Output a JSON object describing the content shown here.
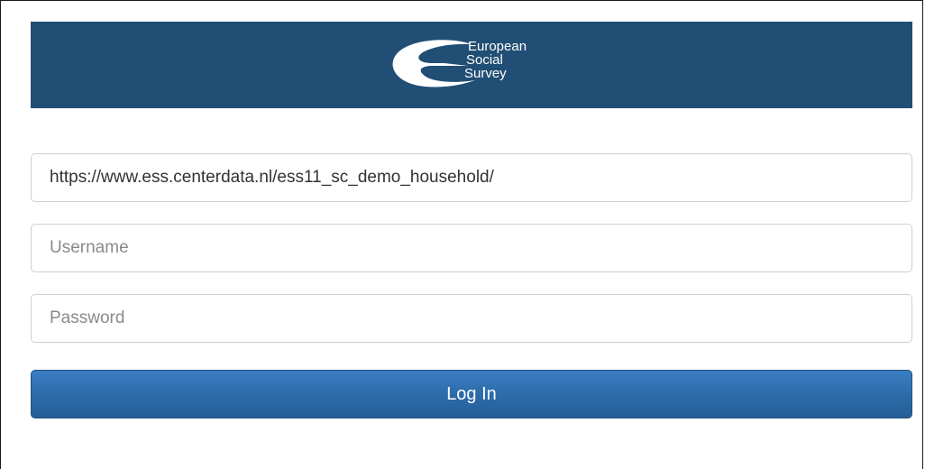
{
  "header": {
    "logo_line1": "European",
    "logo_line2": "Social",
    "logo_line3": "Survey",
    "logo_icon": "ess-swoosh-logo",
    "background_color": "#214e74"
  },
  "form": {
    "url_value": "https://www.ess.centerdata.nl/ess11_sc_demo_household/",
    "username_placeholder": "Username",
    "password_placeholder": "Password",
    "login_label": "Log In",
    "button_color": "#2c6aa8"
  }
}
